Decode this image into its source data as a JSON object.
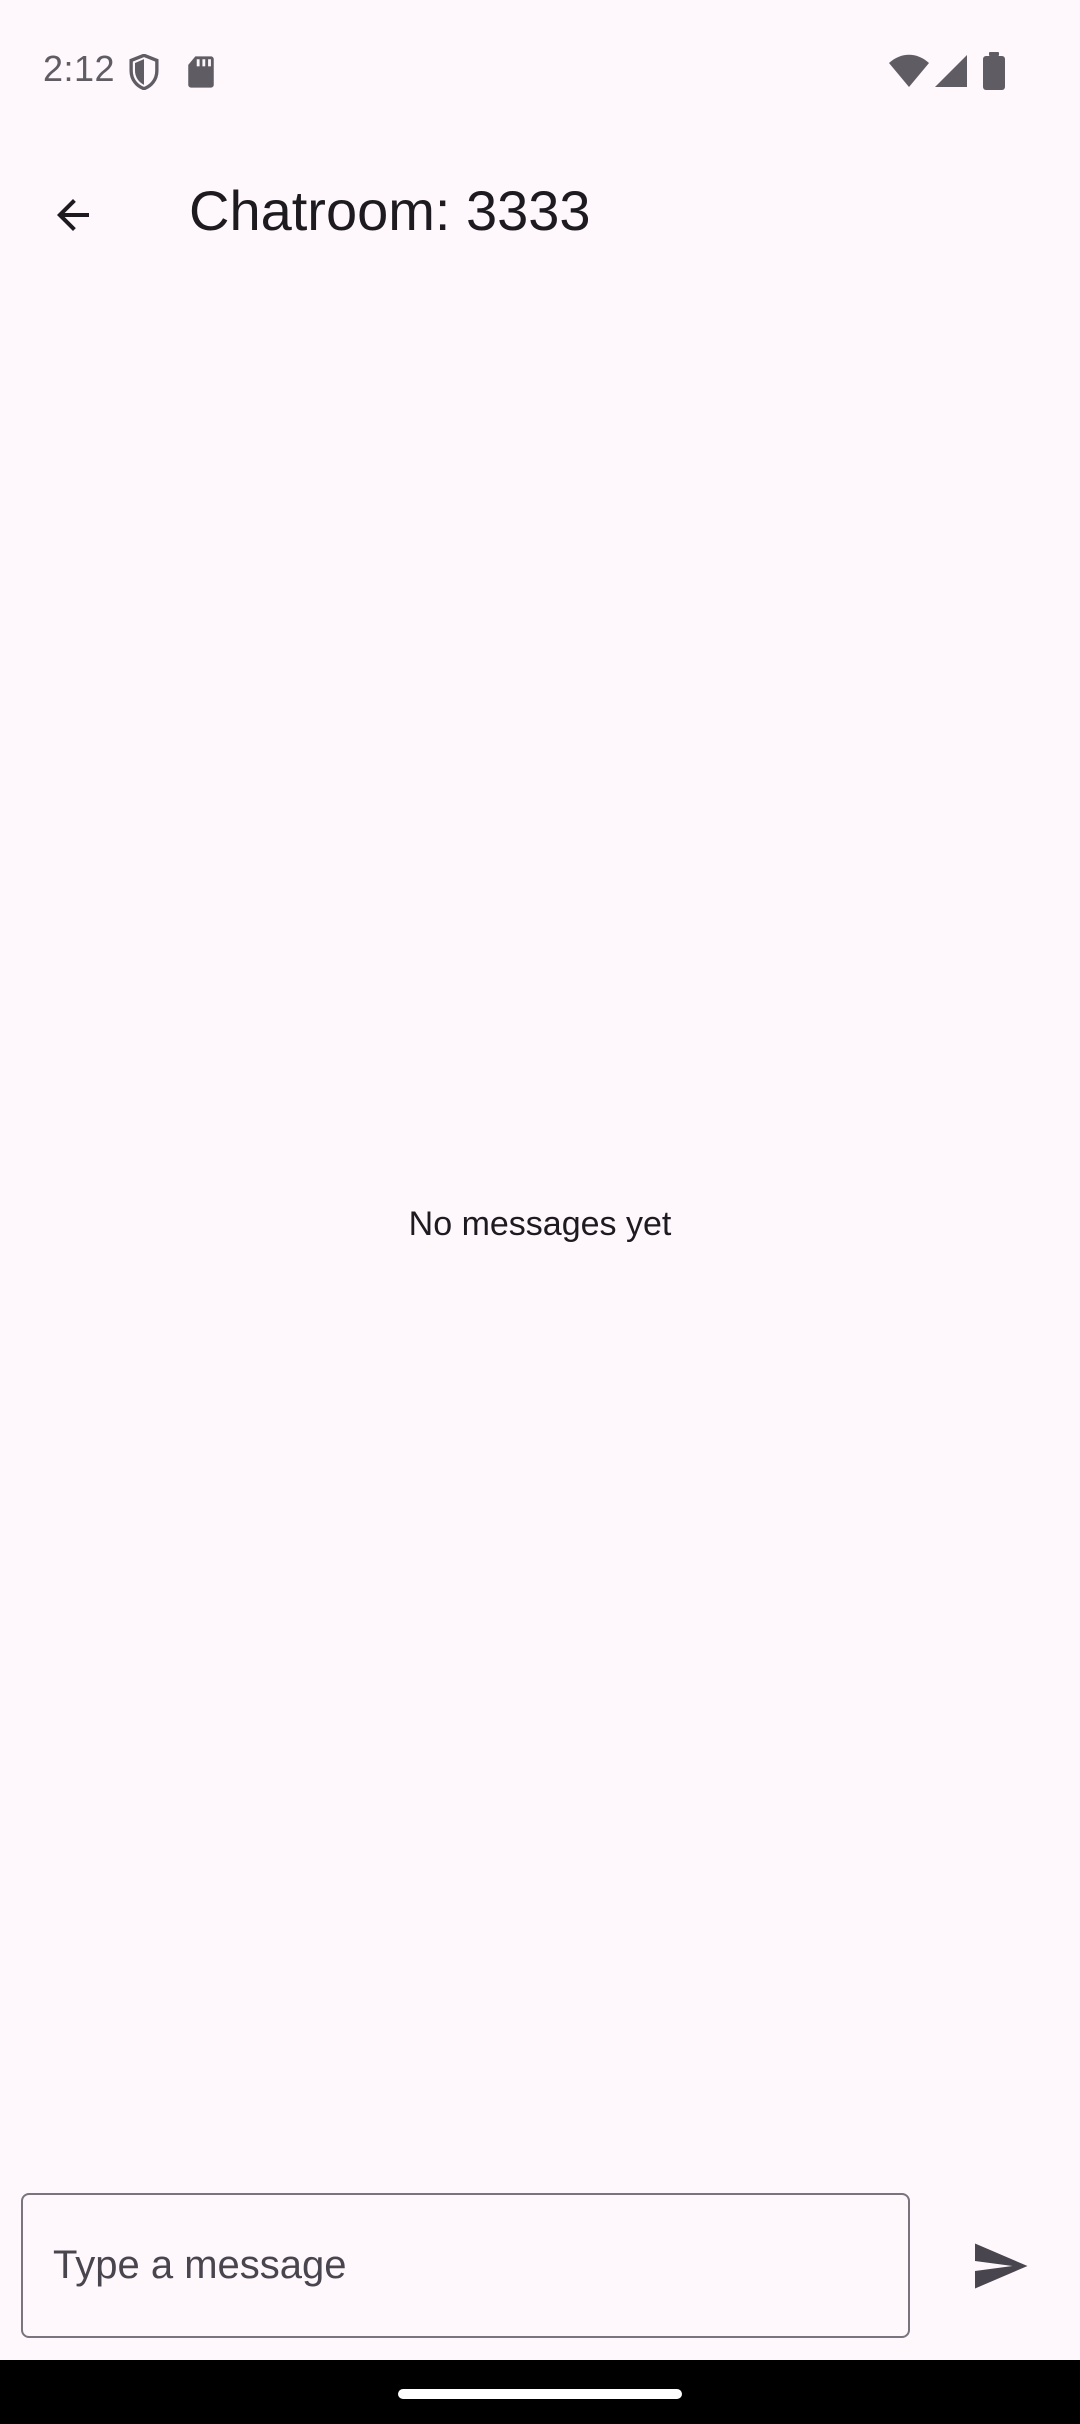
{
  "status_bar": {
    "time": "2:12",
    "icons": [
      "shield-icon",
      "sd-card-icon",
      "wifi-icon",
      "signal-icon",
      "battery-icon"
    ]
  },
  "app_bar": {
    "back_icon": "arrow-back-icon",
    "title": "Chatroom: 3333"
  },
  "chat": {
    "empty_text": "No messages yet"
  },
  "composer": {
    "placeholder": "Type a message",
    "value": "",
    "send_icon": "send-icon"
  },
  "colors": {
    "background": "#FEF7FC",
    "text": "#1D1B20",
    "outline": "#79747E",
    "icon": "#49454F",
    "nav_bar": "#000000"
  }
}
